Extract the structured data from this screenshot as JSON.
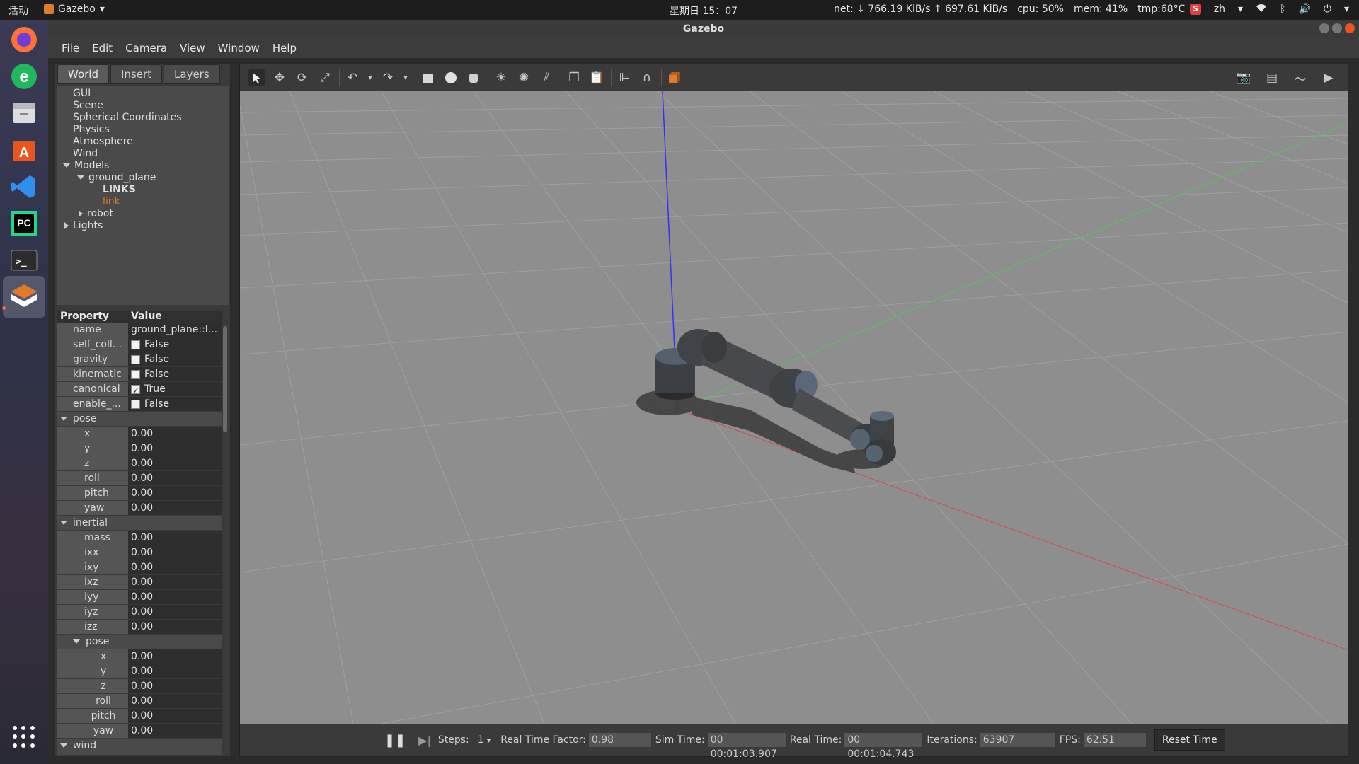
{
  "topbar": {
    "activities": "活动",
    "app_name": "Gazebo",
    "clock": "星期日 15：07",
    "net": "net: ↓ 766.19 KiB/s ↑ 697.61 KiB/s",
    "cpu": "cpu: 50%",
    "mem": "mem: 41%",
    "tmp": "tmp:68°C",
    "lang": "zh"
  },
  "window": {
    "title": "Gazebo"
  },
  "menu": [
    "File",
    "Edit",
    "Camera",
    "View",
    "Window",
    "Help"
  ],
  "tabs": [
    "World",
    "Insert",
    "Layers"
  ],
  "tree": {
    "gui": "GUI",
    "scene": "Scene",
    "spherical": "Spherical Coordinates",
    "physics": "Physics",
    "atmosphere": "Atmosphere",
    "wind": "Wind",
    "models": "Models",
    "ground_plane": "ground_plane",
    "links": "LINKS",
    "link": "link",
    "robot": "robot",
    "lights": "Lights"
  },
  "props": {
    "hdr_property": "Property",
    "hdr_value": "Value",
    "rows": [
      {
        "k": "name",
        "v": "ground_plane::l..."
      },
      {
        "k": "self_coll...",
        "v": "False"
      },
      {
        "k": "gravity",
        "v": "False"
      },
      {
        "k": "kinematic",
        "v": "False"
      },
      {
        "k": "canonical",
        "v": "True"
      },
      {
        "k": "enable_...",
        "v": "False"
      }
    ],
    "pose": "pose",
    "pose_rows": [
      {
        "k": "x",
        "v": "0.00"
      },
      {
        "k": "y",
        "v": "0.00"
      },
      {
        "k": "z",
        "v": "0.00"
      },
      {
        "k": "roll",
        "v": "0.00"
      },
      {
        "k": "pitch",
        "v": "0.00"
      },
      {
        "k": "yaw",
        "v": "0.00"
      }
    ],
    "inertial": "inertial",
    "inertial_rows": [
      {
        "k": "mass",
        "v": "0.00"
      },
      {
        "k": "ixx",
        "v": "0.00"
      },
      {
        "k": "ixy",
        "v": "0.00"
      },
      {
        "k": "ixz",
        "v": "0.00"
      },
      {
        "k": "iyy",
        "v": "0.00"
      },
      {
        "k": "iyz",
        "v": "0.00"
      },
      {
        "k": "izz",
        "v": "0.00"
      }
    ],
    "pose2": "pose",
    "pose2_rows": [
      {
        "k": "x",
        "v": "0.00"
      },
      {
        "k": "y",
        "v": "0.00"
      },
      {
        "k": "z",
        "v": "0.00"
      },
      {
        "k": "roll",
        "v": "0.00"
      },
      {
        "k": "pitch",
        "v": "0.00"
      },
      {
        "k": "yaw",
        "v": "0.00"
      }
    ],
    "wind": "wind"
  },
  "bottom": {
    "steps_label": "Steps:",
    "steps_value": "1",
    "rtf_label": "Real Time Factor:",
    "rtf_value": "0.98",
    "sim_label": "Sim Time:",
    "sim_value": "00 00:01:03.907",
    "real_label": "Real Time:",
    "real_value": "00 00:01:04.743",
    "iter_label": "Iterations:",
    "iter_value": "63907",
    "fps_label": "FPS:",
    "fps_value": "62.51",
    "reset": "Reset Time"
  },
  "colors": {
    "accent": "#e07b2a",
    "scene_bg": "#8e8e8e",
    "grid": "#a6a6a6"
  }
}
